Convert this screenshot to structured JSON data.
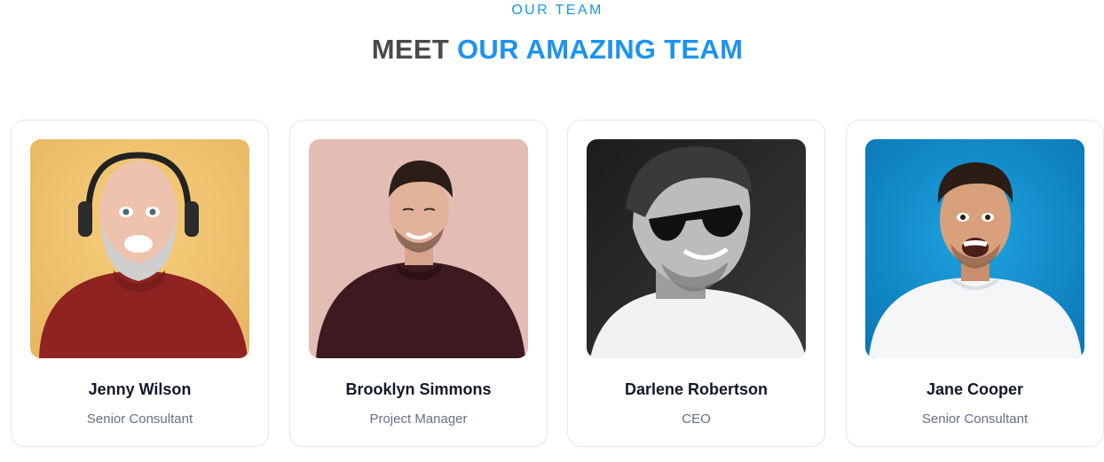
{
  "section": {
    "eyebrow": "OUR TEAM",
    "heading_prefix": "MEET",
    "heading_accent": "OUR AMAZING TEAM"
  },
  "colors": {
    "accent": "#1d93f0",
    "heading": "#4a4a4a",
    "name": "#101828",
    "role": "#667085"
  },
  "team": [
    {
      "name": "Jenny Wilson",
      "role": "Senior Consultant",
      "photo_bg": "#efbe6c"
    },
    {
      "name": "Brooklyn Simmons",
      "role": "Project Manager",
      "photo_bg": "#e3bcb6"
    },
    {
      "name": "Darlene Robertson",
      "role": "CEO",
      "photo_bg": "#2c2c2c"
    },
    {
      "name": "Jane Cooper",
      "role": "Senior Consultant",
      "photo_bg": "#0e87c7"
    }
  ]
}
